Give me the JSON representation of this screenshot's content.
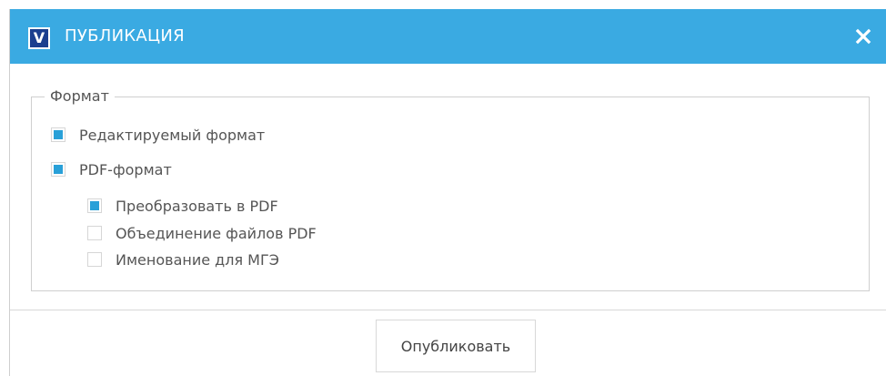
{
  "dialog": {
    "title": "ПУБЛИКАЦИЯ",
    "logo_letter": "V",
    "logo_icon": "app-logo-icon",
    "close_icon": "close-icon",
    "accent_color": "#3aaae2",
    "checked_color": "#29a0d8"
  },
  "format_group": {
    "legend": "Формат",
    "options": [
      {
        "label": "Редактируемый формат",
        "checked": true
      },
      {
        "label": "PDF-формат",
        "checked": true
      },
      {
        "label": "Преобразовать в PDF",
        "checked": true
      },
      {
        "label": "Объединение файлов PDF",
        "checked": false
      },
      {
        "label": "Именование для МГЭ",
        "checked": false
      }
    ]
  },
  "footer": {
    "publish_label": "Опубликовать"
  }
}
